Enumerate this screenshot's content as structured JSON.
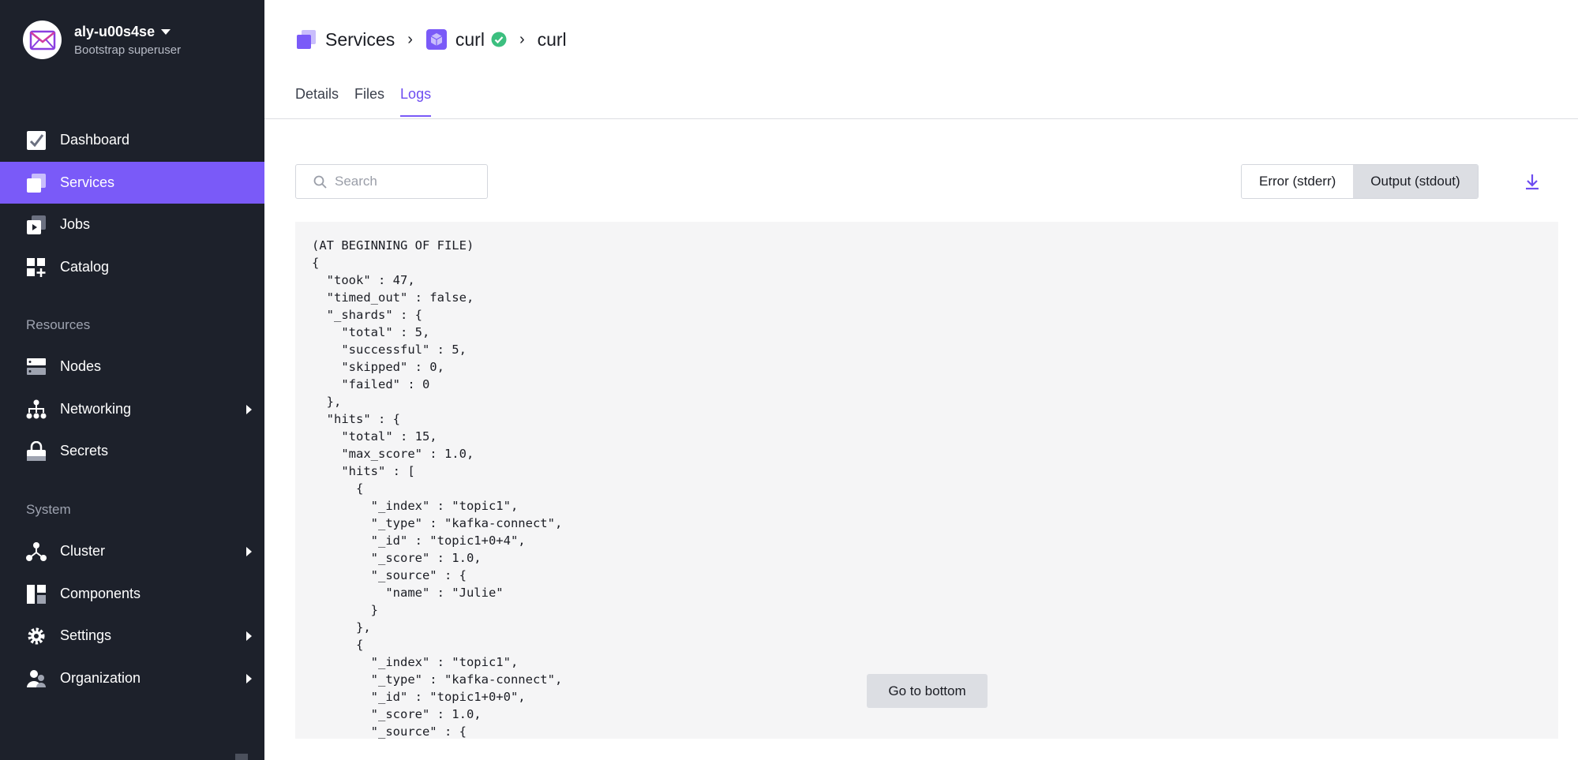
{
  "profile": {
    "username": "aly-u00s4se",
    "role": "Bootstrap superuser"
  },
  "sidebar": {
    "items": [
      {
        "label": "Dashboard"
      },
      {
        "label": "Services"
      },
      {
        "label": "Jobs"
      },
      {
        "label": "Catalog"
      }
    ],
    "resources_heading": "Resources",
    "resources": [
      {
        "label": "Nodes"
      },
      {
        "label": "Networking"
      },
      {
        "label": "Secrets"
      }
    ],
    "system_heading": "System",
    "system": [
      {
        "label": "Cluster"
      },
      {
        "label": "Components"
      },
      {
        "label": "Settings"
      },
      {
        "label": "Organization"
      }
    ]
  },
  "breadcrumb": {
    "root": "Services",
    "service": "curl",
    "page": "curl"
  },
  "tabs": [
    {
      "label": "Details"
    },
    {
      "label": "Files"
    },
    {
      "label": "Logs"
    }
  ],
  "search": {
    "placeholder": "Search",
    "value": ""
  },
  "stream_toggle": {
    "stderr": "Error (stderr)",
    "stdout": "Output (stdout)",
    "selected": "stdout"
  },
  "log": {
    "lines": "(AT BEGINNING OF FILE)\n{\n  \"took\" : 47,\n  \"timed_out\" : false,\n  \"_shards\" : {\n    \"total\" : 5,\n    \"successful\" : 5,\n    \"skipped\" : 0,\n    \"failed\" : 0\n  },\n  \"hits\" : {\n    \"total\" : 15,\n    \"max_score\" : 1.0,\n    \"hits\" : [\n      {\n        \"_index\" : \"topic1\",\n        \"_type\" : \"kafka-connect\",\n        \"_id\" : \"topic1+0+4\",\n        \"_score\" : 1.0,\n        \"_source\" : {\n          \"name\" : \"Julie\"\n        }\n      },\n      {\n        \"_index\" : \"topic1\",\n        \"_type\" : \"kafka-connect\",\n        \"_id\" : \"topic1+0+0\",\n        \"_score\" : 1.0,\n        \"_source\" : {"
  },
  "go_to_bottom": "Go to bottom",
  "colors": {
    "accent": "#7a5af8",
    "sidebar_bg": "#1d212b",
    "healthy": "#3cbf7f"
  }
}
